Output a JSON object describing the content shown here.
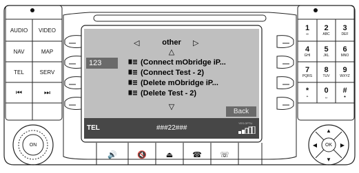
{
  "left_column": {
    "top_buttons": [
      {
        "label": "AUDIO"
      },
      {
        "label": "VIDEO"
      },
      {
        "label": "NAV"
      },
      {
        "label": "MAP"
      },
      {
        "label": "TEL"
      },
      {
        "label": "SERV"
      },
      {
        "label": "⏮"
      },
      {
        "label": "⏭"
      }
    ],
    "knob_label": "ON"
  },
  "screen": {
    "menu_title": "other",
    "left_arrow": "◁",
    "right_arrow": "▷",
    "up_arrow": "△",
    "down_arrow": "▽",
    "input_mode": "123",
    "entries": [
      {
        "text": "(Connect mObridge iP..."
      },
      {
        "text": "(Connect Test - 2)"
      },
      {
        "text": "(Delete mObridge iP..."
      },
      {
        "text": "(Delete Test - 2)"
      }
    ],
    "back_label": "Back"
  },
  "status_bar": {
    "mode": "TEL",
    "dialed_number": "###22###",
    "network": "YES.OPTU"
  },
  "keypad": [
    {
      "num": "1",
      "sub": "∞"
    },
    {
      "num": "2",
      "sub": "ABC"
    },
    {
      "num": "3",
      "sub": "DEF"
    },
    {
      "num": "4",
      "sub": "GHI"
    },
    {
      "num": "5",
      "sub": "JKL"
    },
    {
      "num": "6",
      "sub": "MNO"
    },
    {
      "num": "7",
      "sub": "PQRS"
    },
    {
      "num": "8",
      "sub": "TUV"
    },
    {
      "num": "9",
      "sub": "WXYZ"
    },
    {
      "num": "*",
      "sub": "+"
    },
    {
      "num": "0",
      "sub": "␣"
    },
    {
      "num": "#",
      "sub": "♠"
    }
  ],
  "nav_pad": {
    "center_label": "OK"
  },
  "bottom_bar": [
    "🔊",
    "🔇",
    "⏏",
    "☎",
    "☏"
  ]
}
